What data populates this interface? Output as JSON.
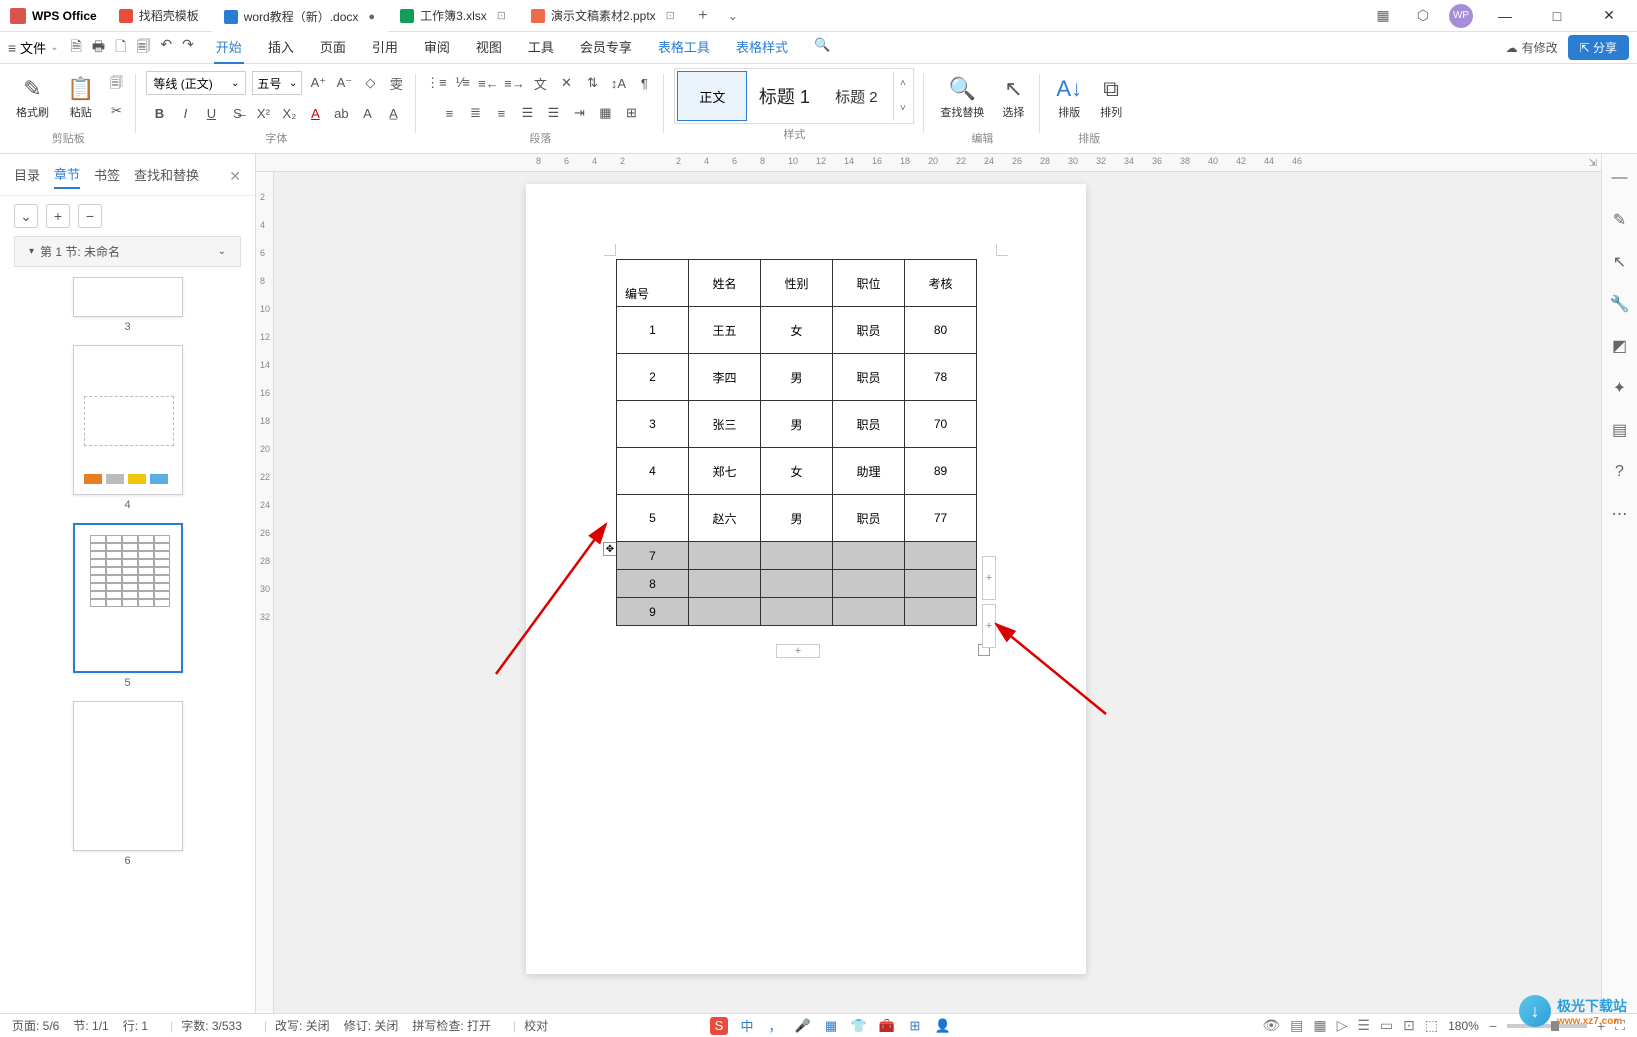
{
  "app": {
    "name": "WPS Office"
  },
  "tabs": [
    {
      "label": "找稻壳模板",
      "icon": "red"
    },
    {
      "label": "word教程（新）.docx",
      "icon": "blue",
      "modified": "●"
    },
    {
      "label": "工作簿3.xlsx",
      "icon": "green",
      "close": "⊡"
    },
    {
      "label": "演示文稿素材2.pptx",
      "icon": "orange",
      "close": "⊡"
    }
  ],
  "titleRight": {
    "modify": "有修改",
    "share": "分享"
  },
  "menu": {
    "file": "文件",
    "tabs": [
      "开始",
      "插入",
      "页面",
      "引用",
      "审阅",
      "视图",
      "工具",
      "会员专享",
      "表格工具",
      "表格样式"
    ],
    "active": "开始"
  },
  "ribbon": {
    "clipboard": {
      "format": "格式刷",
      "paste": "粘贴",
      "label": "剪贴板"
    },
    "font": {
      "name": "等线 (正文)",
      "size": "五号",
      "label": "字体"
    },
    "paragraph": {
      "label": "段落"
    },
    "styles": {
      "normal": "正文",
      "h1": "标题 1",
      "h2": "标题 2",
      "label": "样式"
    },
    "edit": {
      "find": "查找替换",
      "select": "选择",
      "label": "编辑"
    },
    "arrange": {
      "layout": "排版",
      "arr": "排列",
      "label": "排版"
    }
  },
  "leftPanel": {
    "tabs": [
      "目录",
      "章节",
      "书签",
      "查找和替换"
    ],
    "active": "章节",
    "section": "第 1 节: 未命名",
    "thumbs": [
      "3",
      "4",
      "5",
      "6"
    ],
    "selected": "5"
  },
  "rulerH": [
    "8",
    "6",
    "4",
    "2",
    "",
    "2",
    "4",
    "6",
    "8",
    "10",
    "12",
    "14",
    "16",
    "18",
    "20",
    "22",
    "24",
    "26",
    "28",
    "30",
    "32",
    "34",
    "36",
    "38",
    "40",
    "42",
    "44",
    "46"
  ],
  "rulerV": [
    "2",
    "4",
    "6",
    "8",
    "10",
    "12",
    "14",
    "16",
    "18",
    "20",
    "22",
    "24",
    "26",
    "28",
    "30",
    "32"
  ],
  "table": {
    "headers": [
      "编号",
      "姓名",
      "性别",
      "职位",
      "考核"
    ],
    "rows": [
      [
        "1",
        "王五",
        "女",
        "职员",
        "80"
      ],
      [
        "2",
        "李四",
        "男",
        "职员",
        "78"
      ],
      [
        "3",
        "张三",
        "男",
        "职员",
        "70"
      ],
      [
        "4",
        "郑七",
        "女",
        "助理",
        "89"
      ],
      [
        "5",
        "赵六",
        "男",
        "职员",
        "77"
      ]
    ],
    "selectedRows": [
      [
        "7",
        "",
        "",
        "",
        ""
      ],
      [
        "8",
        "",
        "",
        "",
        ""
      ],
      [
        "9",
        "",
        "",
        "",
        ""
      ]
    ]
  },
  "status": {
    "page": "页面: 5/6",
    "section": "节: 1/1",
    "row": "行: 1",
    "words": "字数: 3/533",
    "change": "改写: 关闭",
    "revise": "修订: 关闭",
    "spell": "拼写检查: 打开",
    "proof": "校对",
    "ime": "中",
    "zoom": "180%"
  },
  "watermark": {
    "text": "极光下载站",
    "url": "www.xz7.com"
  }
}
